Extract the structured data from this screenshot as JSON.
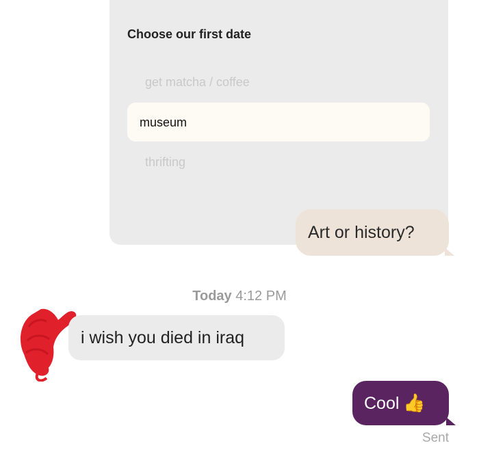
{
  "prompt": {
    "title": "Choose our first date",
    "options": [
      "get matcha / coffee",
      "museum",
      "thrifting"
    ],
    "selected_index": 1
  },
  "messages": {
    "outgoing_question": "Art or history?",
    "timestamp_day": "Today",
    "timestamp_time": "4:12 PM",
    "incoming_reply": "i wish you died in iraq",
    "outgoing_reply": "Cool",
    "outgoing_reply_emoji": "👍",
    "status": "Sent"
  },
  "colors": {
    "card_background": "#ebebeb",
    "selected_option_background": "#fdfbf3",
    "sent_bubble_beige": "#ede3d9",
    "sent_bubble_purple": "#5a2461",
    "avatar_scribble": "#e0202a"
  },
  "icons": {
    "avatar": "redacted-avatar-scribble",
    "emoji": "thumbs-up-emoji"
  }
}
